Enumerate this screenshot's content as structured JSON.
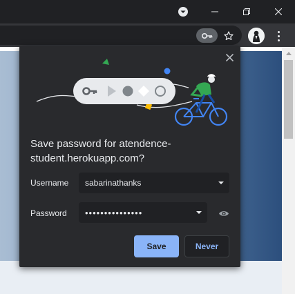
{
  "window": {
    "icons": [
      "profile-menu-icon",
      "minimize-icon",
      "maximize-icon",
      "close-icon"
    ]
  },
  "toolbar": {
    "icons": [
      "key-icon",
      "star-icon",
      "avatar",
      "kebab-menu-icon"
    ]
  },
  "dialog": {
    "title": "Save password for atendence-student.herokuapp.com?",
    "username_label": "Username",
    "username_value": "sabarinathanks",
    "password_label": "Password",
    "password_value": "•••••••••••••••",
    "save_label": "Save",
    "never_label": "Never"
  },
  "colors": {
    "dialog_bg": "#292a2d",
    "accent": "#8ab4f8",
    "field_bg": "#202124"
  }
}
